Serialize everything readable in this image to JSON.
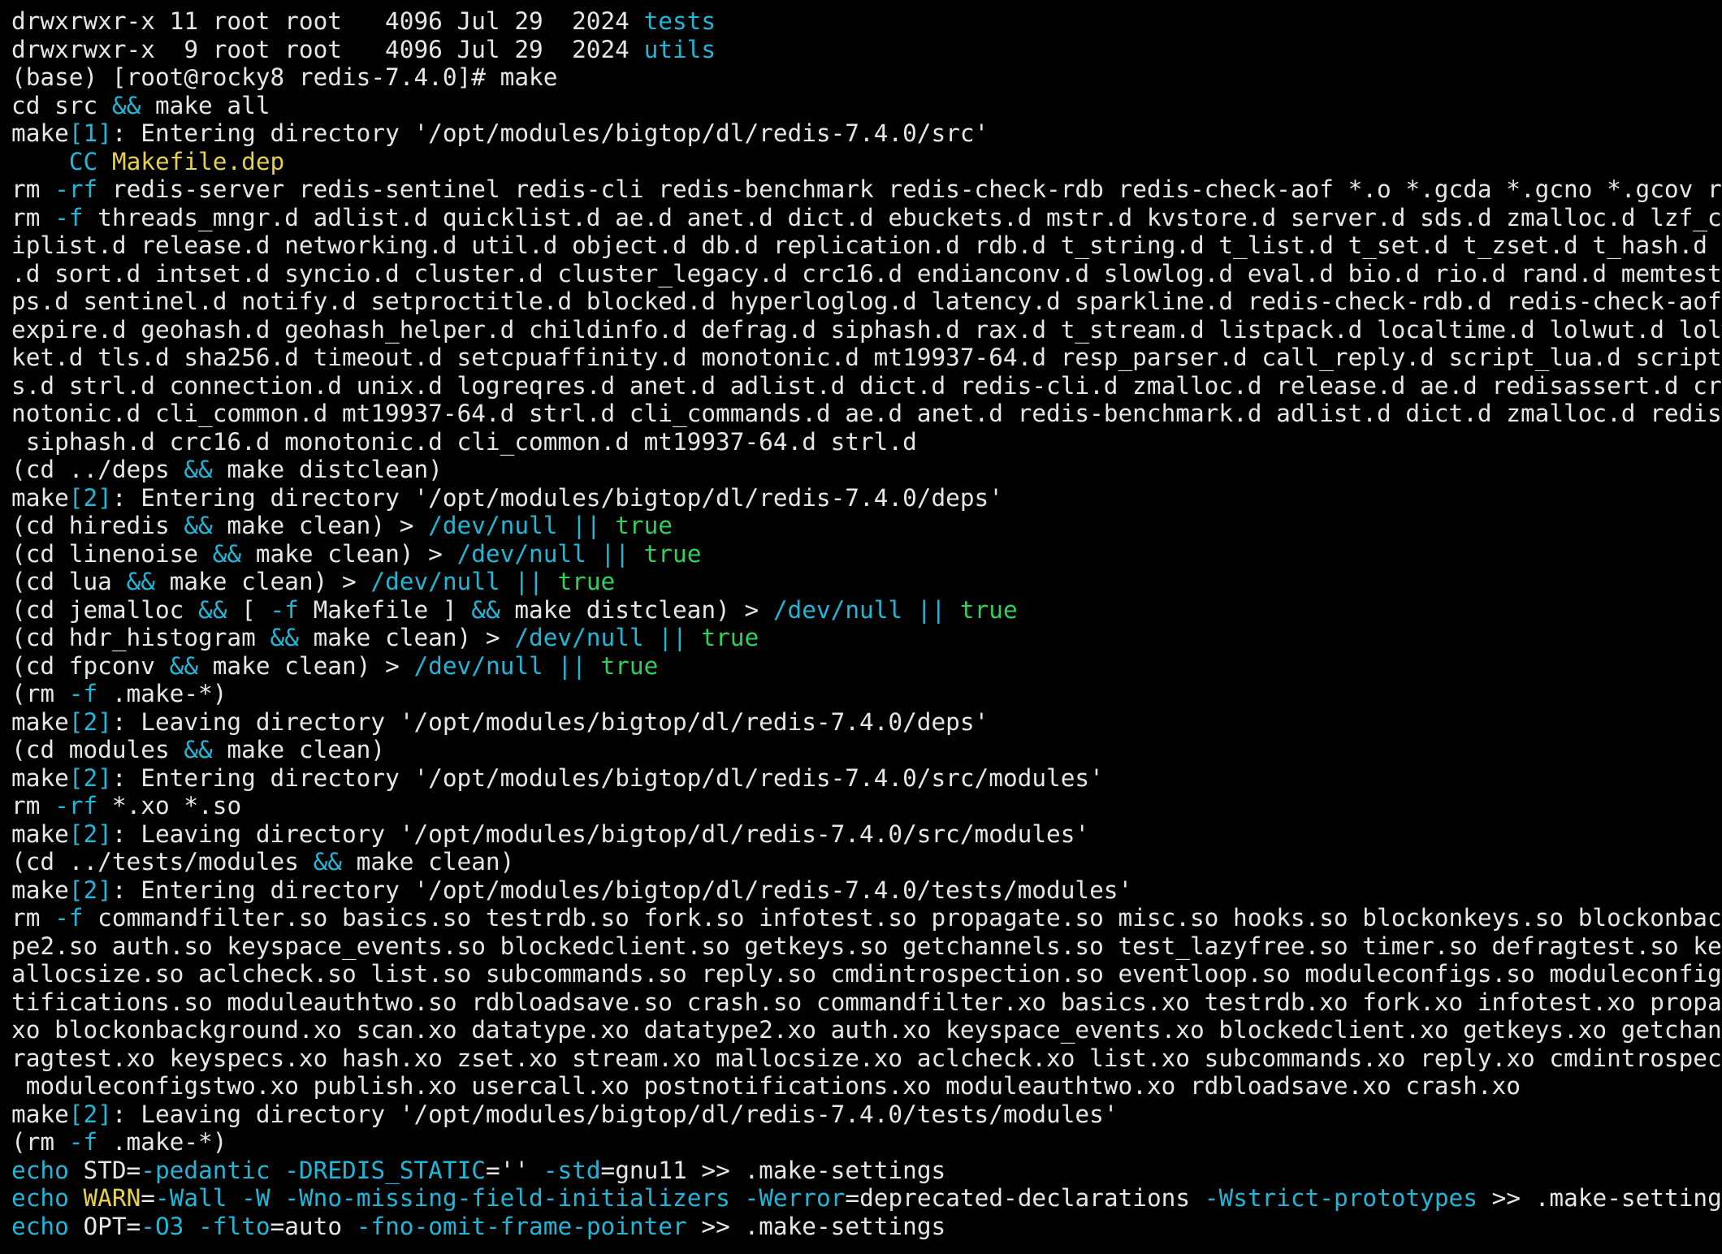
{
  "window": {
    "type": "terminal",
    "prompt": "(base) [root@rocky8 redis-7.4.0]# "
  },
  "colors": {
    "background": "#000000",
    "text": "#e6e6e6",
    "cyan": "#1fb6d8",
    "green": "#2fd15a",
    "yellow": "#e5d24a"
  },
  "lines": [
    [
      {
        "t": "drwxrwxr-x 11 root root   4096 Jul 29  2024 ",
        "c": "w"
      },
      {
        "t": "tests",
        "c": "b"
      }
    ],
    [
      {
        "t": "drwxrwxr-x  9 root root   4096 Jul 29  2024 ",
        "c": "w"
      },
      {
        "t": "utils",
        "c": "b"
      }
    ],
    [
      {
        "t": "(base) [root@rocky8 redis-7.4.0]# make",
        "c": "w"
      }
    ],
    [
      {
        "t": "cd src ",
        "c": "w"
      },
      {
        "t": "&&",
        "c": "b"
      },
      {
        "t": " make all",
        "c": "w"
      }
    ],
    [
      {
        "t": "make",
        "c": "w"
      },
      {
        "t": "[1]",
        "c": "b"
      },
      {
        "t": ": Entering directory '/opt/modules/bigtop/dl/redis-7.4.0/src'",
        "c": "w"
      }
    ],
    [
      {
        "t": "    ",
        "c": "w"
      },
      {
        "t": "CC",
        "c": "b"
      },
      {
        "t": " ",
        "c": "w"
      },
      {
        "t": "Makefile.dep",
        "c": "y"
      }
    ],
    [
      {
        "t": "rm ",
        "c": "w"
      },
      {
        "t": "-rf",
        "c": "b"
      },
      {
        "t": " redis-server redis-sentinel redis-cli redis-benchmark redis-check-rdb redis-check-aof *.o *.gcda *.gcno *.gcov redi",
        "c": "w"
      }
    ],
    [
      {
        "t": "rm ",
        "c": "w"
      },
      {
        "t": "-f",
        "c": "b"
      },
      {
        "t": " threads_mngr.d adlist.d quicklist.d ae.d anet.d dict.d ebuckets.d mstr.d kvstore.d server.d sds.d zmalloc.d lzf_c.d",
        "c": "w"
      }
    ],
    [
      {
        "t": "iplist.d release.d networking.d util.d object.d db.d replication.d rdb.d t_string.d t_list.d t_set.d t_zset.d t_hash.d con",
        "c": "w"
      }
    ],
    [
      {
        "t": ".d sort.d intset.d syncio.d cluster.d cluster_legacy.d crc16.d endianconv.d slowlog.d eval.d bio.d rio.d rand.d memtest.d",
        "c": "w"
      }
    ],
    [
      {
        "t": "ps.d sentinel.d notify.d setproctitle.d blocked.d hyperloglog.d latency.d sparkline.d redis-check-rdb.d redis-check-aof.d",
        "c": "w"
      }
    ],
    [
      {
        "t": "expire.d geohash.d geohash_helper.d childinfo.d defrag.d siphash.d rax.d t_stream.d listpack.d localtime.d lolwut.d lolwut",
        "c": "w"
      }
    ],
    [
      {
        "t": "ket.d tls.d sha256.d timeout.d setcpuaffinity.d monotonic.d mt19937-64.d resp_parser.d call_reply.d script_lua.d script.d",
        "c": "w"
      }
    ],
    [
      {
        "t": "s.d strl.d connection.d unix.d logreqres.d anet.d adlist.d dict.d redis-cli.d zmalloc.d release.d ae.d redisassert.d crcsp",
        "c": "w"
      }
    ],
    [
      {
        "t": "notonic.d cli_common.d mt19937-64.d strl.d cli_commands.d ae.d anet.d redis-benchmark.d adlist.d dict.d zmalloc.d redisass",
        "c": "w"
      }
    ],
    [
      {
        "t": " siphash.d crc16.d monotonic.d cli_common.d mt19937-64.d strl.d",
        "c": "w"
      }
    ],
    [
      {
        "t": "(cd ../deps ",
        "c": "w"
      },
      {
        "t": "&&",
        "c": "b"
      },
      {
        "t": " make distclean)",
        "c": "w"
      }
    ],
    [
      {
        "t": "make",
        "c": "w"
      },
      {
        "t": "[2]",
        "c": "b"
      },
      {
        "t": ": Entering directory '/opt/modules/bigtop/dl/redis-7.4.0/deps'",
        "c": "w"
      }
    ],
    [
      {
        "t": "(cd hiredis ",
        "c": "w"
      },
      {
        "t": "&&",
        "c": "b"
      },
      {
        "t": " make clean) > ",
        "c": "w"
      },
      {
        "t": "/dev/null",
        "c": "b"
      },
      {
        "t": " ",
        "c": "w"
      },
      {
        "t": "||",
        "c": "b"
      },
      {
        "t": " ",
        "c": "w"
      },
      {
        "t": "true",
        "c": "g"
      }
    ],
    [
      {
        "t": "(cd linenoise ",
        "c": "w"
      },
      {
        "t": "&&",
        "c": "b"
      },
      {
        "t": " make clean) > ",
        "c": "w"
      },
      {
        "t": "/dev/null",
        "c": "b"
      },
      {
        "t": " ",
        "c": "w"
      },
      {
        "t": "||",
        "c": "b"
      },
      {
        "t": " ",
        "c": "w"
      },
      {
        "t": "true",
        "c": "g"
      }
    ],
    [
      {
        "t": "(cd lua ",
        "c": "w"
      },
      {
        "t": "&&",
        "c": "b"
      },
      {
        "t": " make clean) > ",
        "c": "w"
      },
      {
        "t": "/dev/null",
        "c": "b"
      },
      {
        "t": " ",
        "c": "w"
      },
      {
        "t": "||",
        "c": "b"
      },
      {
        "t": " ",
        "c": "w"
      },
      {
        "t": "true",
        "c": "g"
      }
    ],
    [
      {
        "t": "(cd jemalloc ",
        "c": "w"
      },
      {
        "t": "&&",
        "c": "b"
      },
      {
        "t": " [ ",
        "c": "w"
      },
      {
        "t": "-f",
        "c": "b"
      },
      {
        "t": " Makefile ] ",
        "c": "w"
      },
      {
        "t": "&&",
        "c": "b"
      },
      {
        "t": " make distclean) > ",
        "c": "w"
      },
      {
        "t": "/dev/null",
        "c": "b"
      },
      {
        "t": " ",
        "c": "w"
      },
      {
        "t": "||",
        "c": "b"
      },
      {
        "t": " ",
        "c": "w"
      },
      {
        "t": "true",
        "c": "g"
      }
    ],
    [
      {
        "t": "(cd hdr_histogram ",
        "c": "w"
      },
      {
        "t": "&&",
        "c": "b"
      },
      {
        "t": " make clean) > ",
        "c": "w"
      },
      {
        "t": "/dev/null",
        "c": "b"
      },
      {
        "t": " ",
        "c": "w"
      },
      {
        "t": "||",
        "c": "b"
      },
      {
        "t": " ",
        "c": "w"
      },
      {
        "t": "true",
        "c": "g"
      }
    ],
    [
      {
        "t": "(cd fpconv ",
        "c": "w"
      },
      {
        "t": "&&",
        "c": "b"
      },
      {
        "t": " make clean) > ",
        "c": "w"
      },
      {
        "t": "/dev/null",
        "c": "b"
      },
      {
        "t": " ",
        "c": "w"
      },
      {
        "t": "||",
        "c": "b"
      },
      {
        "t": " ",
        "c": "w"
      },
      {
        "t": "true",
        "c": "g"
      }
    ],
    [
      {
        "t": "(rm ",
        "c": "w"
      },
      {
        "t": "-f",
        "c": "b"
      },
      {
        "t": " .make-*)",
        "c": "w"
      }
    ],
    [
      {
        "t": "make",
        "c": "w"
      },
      {
        "t": "[2]",
        "c": "b"
      },
      {
        "t": ": Leaving directory '/opt/modules/bigtop/dl/redis-7.4.0/deps'",
        "c": "w"
      }
    ],
    [
      {
        "t": "(cd modules ",
        "c": "w"
      },
      {
        "t": "&&",
        "c": "b"
      },
      {
        "t": " make clean)",
        "c": "w"
      }
    ],
    [
      {
        "t": "make",
        "c": "w"
      },
      {
        "t": "[2]",
        "c": "b"
      },
      {
        "t": ": Entering directory '/opt/modules/bigtop/dl/redis-7.4.0/src/modules'",
        "c": "w"
      }
    ],
    [
      {
        "t": "rm ",
        "c": "w"
      },
      {
        "t": "-rf",
        "c": "b"
      },
      {
        "t": " *.xo *.so",
        "c": "w"
      }
    ],
    [
      {
        "t": "make",
        "c": "w"
      },
      {
        "t": "[2]",
        "c": "b"
      },
      {
        "t": ": Leaving directory '/opt/modules/bigtop/dl/redis-7.4.0/src/modules'",
        "c": "w"
      }
    ],
    [
      {
        "t": "(cd ../tests/modules ",
        "c": "w"
      },
      {
        "t": "&&",
        "c": "b"
      },
      {
        "t": " make clean)",
        "c": "w"
      }
    ],
    [
      {
        "t": "make",
        "c": "w"
      },
      {
        "t": "[2]",
        "c": "b"
      },
      {
        "t": ": Entering directory '/opt/modules/bigtop/dl/redis-7.4.0/tests/modules'",
        "c": "w"
      }
    ],
    [
      {
        "t": "rm ",
        "c": "w"
      },
      {
        "t": "-f",
        "c": "b"
      },
      {
        "t": " commandfilter.so basics.so testrdb.so fork.so infotest.so propagate.so misc.so hooks.so blockonkeys.so blockonbackgr",
        "c": "w"
      }
    ],
    [
      {
        "t": "pe2.so auth.so keyspace_events.so blockedclient.so getkeys.so getchannels.so test_lazyfree.so timer.so defragtest.so keysp",
        "c": "w"
      }
    ],
    [
      {
        "t": "allocsize.so aclcheck.so list.so subcommands.so reply.so cmdintrospection.so eventloop.so moduleconfigs.so moduleconfigstw",
        "c": "w"
      }
    ],
    [
      {
        "t": "tifications.so moduleauthtwo.so rdbloadsave.so crash.so commandfilter.xo basics.xo testrdb.xo fork.xo infotest.xo propagat",
        "c": "w"
      }
    ],
    [
      {
        "t": "xo blockonbackground.xo scan.xo datatype.xo datatype2.xo auth.xo keyspace_events.xo blockedclient.xo getkeys.xo getchannel",
        "c": "w"
      }
    ],
    [
      {
        "t": "ragtest.xo keyspecs.xo hash.xo zset.xo stream.xo mallocsize.xo aclcheck.xo list.xo subcommands.xo reply.xo cmdintrospectio",
        "c": "w"
      }
    ],
    [
      {
        "t": " moduleconfigstwo.xo publish.xo usercall.xo postnotifications.xo moduleauthtwo.xo rdbloadsave.xo crash.xo",
        "c": "w"
      }
    ],
    [
      {
        "t": "make",
        "c": "w"
      },
      {
        "t": "[2]",
        "c": "b"
      },
      {
        "t": ": Leaving directory '/opt/modules/bigtop/dl/redis-7.4.0/tests/modules'",
        "c": "w"
      }
    ],
    [
      {
        "t": "(rm ",
        "c": "w"
      },
      {
        "t": "-f",
        "c": "b"
      },
      {
        "t": " .make-*)",
        "c": "w"
      }
    ],
    [
      {
        "t": "echo",
        "c": "b"
      },
      {
        "t": " STD=",
        "c": "w"
      },
      {
        "t": "-pedantic",
        "c": "b"
      },
      {
        "t": " ",
        "c": "w"
      },
      {
        "t": "-DREDIS_STATIC",
        "c": "b"
      },
      {
        "t": "='' ",
        "c": "w"
      },
      {
        "t": "-std",
        "c": "b"
      },
      {
        "t": "=gnu11 >> .make-settings",
        "c": "w"
      }
    ],
    [
      {
        "t": "echo",
        "c": "b"
      },
      {
        "t": " ",
        "c": "w"
      },
      {
        "t": "WARN",
        "c": "y"
      },
      {
        "t": "=",
        "c": "w"
      },
      {
        "t": "-Wall",
        "c": "b"
      },
      {
        "t": " ",
        "c": "w"
      },
      {
        "t": "-W",
        "c": "b"
      },
      {
        "t": " ",
        "c": "w"
      },
      {
        "t": "-Wno-missing-field-initializers",
        "c": "b"
      },
      {
        "t": " ",
        "c": "w"
      },
      {
        "t": "-Werror",
        "c": "b"
      },
      {
        "t": "=deprecated-declarations ",
        "c": "w"
      },
      {
        "t": "-Wstrict-prototypes",
        "c": "b"
      },
      {
        "t": " >> .make-settings",
        "c": "w"
      }
    ],
    [
      {
        "t": "echo",
        "c": "b"
      },
      {
        "t": " OPT=",
        "c": "w"
      },
      {
        "t": "-O3",
        "c": "b"
      },
      {
        "t": " ",
        "c": "w"
      },
      {
        "t": "-flto",
        "c": "b"
      },
      {
        "t": "=auto ",
        "c": "w"
      },
      {
        "t": "-fno-omit-frame-pointer",
        "c": "b"
      },
      {
        "t": " >> .make-settings",
        "c": "w"
      }
    ]
  ]
}
